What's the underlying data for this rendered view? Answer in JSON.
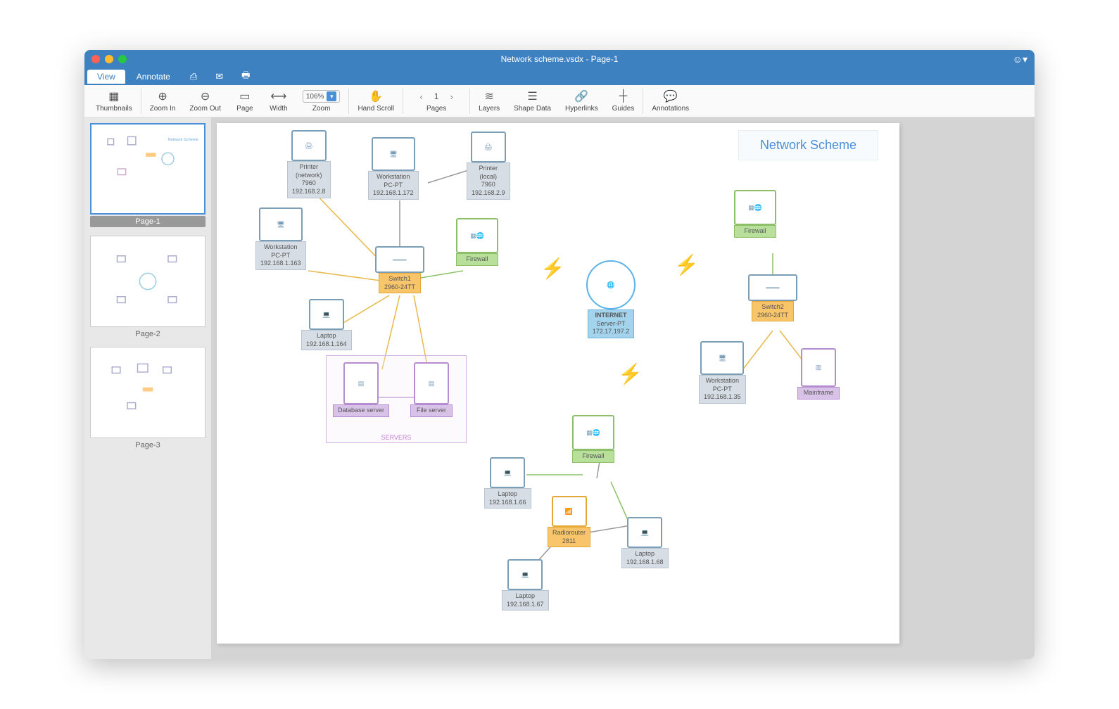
{
  "window": {
    "title": "Network scheme.vsdx - Page-1"
  },
  "tabs": {
    "view": "View",
    "annotate": "Annotate"
  },
  "toolbar": {
    "thumbnails": "Thumbnails",
    "zoom_in": "Zoom In",
    "zoom_out": "Zoom Out",
    "page": "Page",
    "width": "Width",
    "zoom": "Zoom",
    "zoom_value": "106%",
    "hand_scroll": "Hand Scroll",
    "pages": "Pages",
    "page_num": "1",
    "layers": "Layers",
    "shape_data": "Shape Data",
    "hyperlinks": "Hyperlinks",
    "guides": "Guides",
    "annotations": "Annotations"
  },
  "thumbnails": [
    {
      "label": "Page-1"
    },
    {
      "label": "Page-2"
    },
    {
      "label": "Page-3"
    }
  ],
  "diagram": {
    "title": "Network Scheme",
    "servers_group": "SERVERS",
    "nodes": {
      "printer_net": {
        "l1": "Printer",
        "l2": "(network)",
        "l3": "7960",
        "l4": "192.168.2.8"
      },
      "workstation1": {
        "l1": "Workstation",
        "l2": "PC-PT",
        "l3": "192.168.1.172"
      },
      "printer_local": {
        "l1": "Printer",
        "l2": "(local)",
        "l3": "7960",
        "l4": "192.168.2.9"
      },
      "workstation2": {
        "l1": "Workstation",
        "l2": "PC-PT",
        "l3": "192.168.1.163"
      },
      "switch1": {
        "l1": "Switch1",
        "l2": "2960-24TT"
      },
      "firewall1": {
        "l1": "Firewall"
      },
      "laptop1": {
        "l1": "Laptop",
        "l2": "192.168.1.164"
      },
      "db_server": {
        "l1": "Database server"
      },
      "file_server": {
        "l1": "File server"
      },
      "internet": {
        "l1": "INTERNET",
        "l2": "Server-PT",
        "l3": "172.17.197.2"
      },
      "firewall2": {
        "l1": "Firewall"
      },
      "switch2": {
        "l1": "Switch2",
        "l2": "2960-24TT"
      },
      "workstation3": {
        "l1": "Workstation",
        "l2": "PC-PT",
        "l3": "192.168.1.35"
      },
      "mainframe": {
        "l1": "Mainframe"
      },
      "firewall3": {
        "l1": "Firewall"
      },
      "laptop2": {
        "l1": "Laptop",
        "l2": "192.168.1.66"
      },
      "radiorouter": {
        "l1": "Radiorouter",
        "l2": "2811"
      },
      "laptop3": {
        "l1": "Laptop",
        "l2": "192.168.1.68"
      },
      "laptop4": {
        "l1": "Laptop",
        "l2": "192.168.1.67"
      }
    }
  }
}
